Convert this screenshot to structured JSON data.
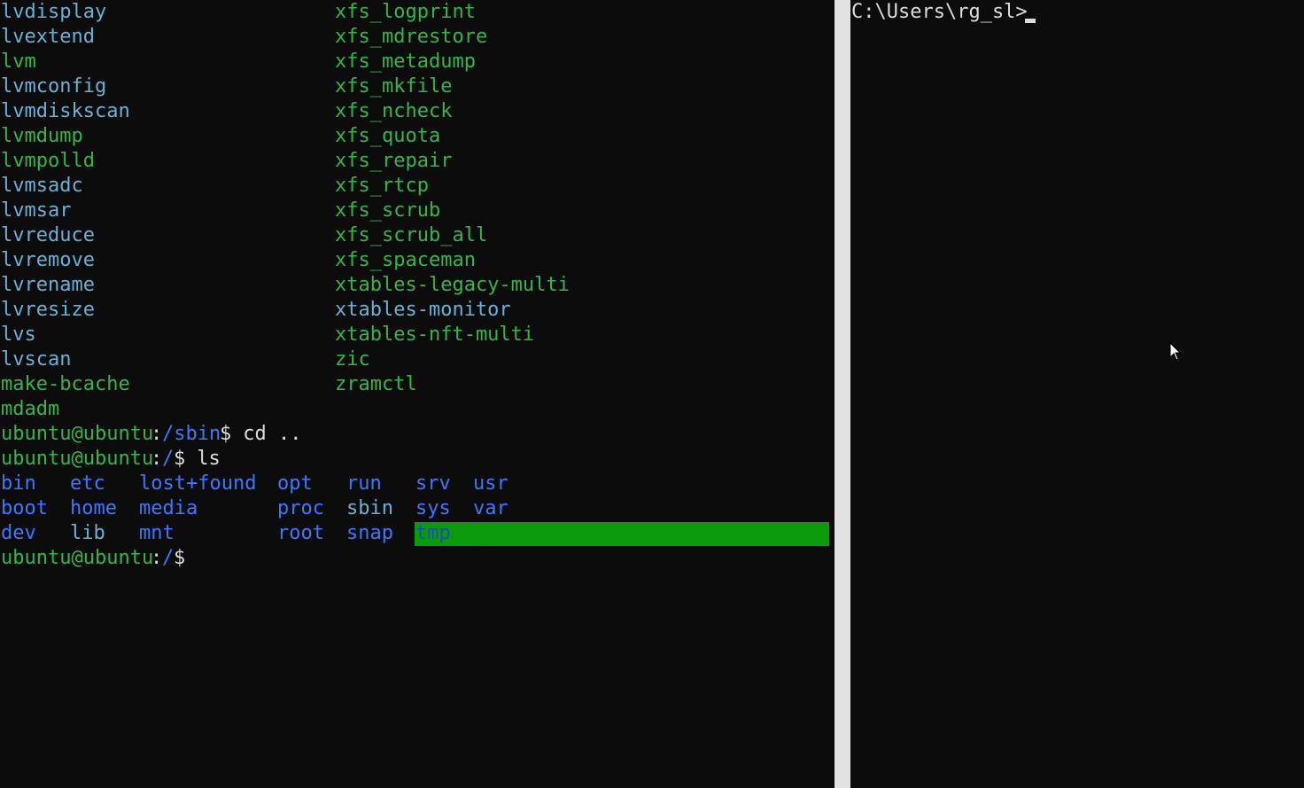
{
  "left_terminal": {
    "col1": [
      {
        "text": "lvdisplay",
        "color": "cyan"
      },
      {
        "text": "lvextend",
        "color": "cyan"
      },
      {
        "text": "lvm",
        "color": "green"
      },
      {
        "text": "lvmconfig",
        "color": "cyan"
      },
      {
        "text": "lvmdiskscan",
        "color": "cyan"
      },
      {
        "text": "lvmdump",
        "color": "green"
      },
      {
        "text": "lvmpolld",
        "color": "green"
      },
      {
        "text": "lvmsadc",
        "color": "cyan"
      },
      {
        "text": "lvmsar",
        "color": "cyan"
      },
      {
        "text": "lvreduce",
        "color": "cyan"
      },
      {
        "text": "lvremove",
        "color": "cyan"
      },
      {
        "text": "lvrename",
        "color": "cyan"
      },
      {
        "text": "lvresize",
        "color": "cyan"
      },
      {
        "text": "lvs",
        "color": "cyan"
      },
      {
        "text": "lvscan",
        "color": "cyan"
      },
      {
        "text": "make-bcache",
        "color": "green"
      },
      {
        "text": "mdadm",
        "color": "green"
      }
    ],
    "col2": [
      {
        "text": "xfs_logprint",
        "color": "green"
      },
      {
        "text": "xfs_mdrestore",
        "color": "green"
      },
      {
        "text": "xfs_metadump",
        "color": "green"
      },
      {
        "text": "xfs_mkfile",
        "color": "green"
      },
      {
        "text": "xfs_ncheck",
        "color": "green"
      },
      {
        "text": "xfs_quota",
        "color": "green"
      },
      {
        "text": "xfs_repair",
        "color": "green"
      },
      {
        "text": "xfs_rtcp",
        "color": "green"
      },
      {
        "text": "xfs_scrub",
        "color": "green"
      },
      {
        "text": "xfs_scrub_all",
        "color": "green"
      },
      {
        "text": "xfs_spaceman",
        "color": "green"
      },
      {
        "text": "xtables-legacy-multi",
        "color": "green"
      },
      {
        "text": "xtables-monitor",
        "color": "cyan"
      },
      {
        "text": "xtables-nft-multi",
        "color": "green"
      },
      {
        "text": "zic",
        "color": "green"
      },
      {
        "text": "zramctl",
        "color": "green"
      }
    ],
    "prompt1": {
      "user_host": "ubuntu@ubuntu",
      "sep": ":",
      "path": "/sbin",
      "dollar": "$",
      "cmd": " cd .."
    },
    "prompt2": {
      "user_host": "ubuntu@ubuntu",
      "sep": ":",
      "path": "/",
      "dollar": "$",
      "cmd": " ls"
    },
    "ls_rows": [
      [
        {
          "text": "bin",
          "color": "blue"
        },
        {
          "text": "etc",
          "color": "blue"
        },
        {
          "text": "lost+found",
          "color": "blue"
        },
        {
          "text": "opt",
          "color": "blue"
        },
        {
          "text": "run",
          "color": "blue"
        },
        {
          "text": "srv",
          "color": "blue"
        },
        {
          "text": "usr",
          "color": "blue"
        }
      ],
      [
        {
          "text": "boot",
          "color": "blue"
        },
        {
          "text": "home",
          "color": "blue"
        },
        {
          "text": "media",
          "color": "blue"
        },
        {
          "text": "proc",
          "color": "blue"
        },
        {
          "text": "sbin",
          "color": "cyan"
        },
        {
          "text": "sys",
          "color": "blue"
        },
        {
          "text": "var",
          "color": "blue"
        }
      ],
      [
        {
          "text": "dev",
          "color": "blue"
        },
        {
          "text": "lib",
          "color": "cyan"
        },
        {
          "text": "mnt",
          "color": "blue"
        },
        {
          "text": "root",
          "color": "blue"
        },
        {
          "text": "snap",
          "color": "blue"
        },
        {
          "text": "tmp",
          "color": "highlight"
        }
      ]
    ],
    "prompt3": {
      "user_host": "ubuntu@ubuntu",
      "sep": ":",
      "path": "/",
      "dollar": "$"
    }
  },
  "right_terminal": {
    "prompt": "C:\\Users\\rg_sl>"
  },
  "colors": {
    "background": "#0c0c0c",
    "green": "#35b548",
    "cyan": "#6ab0d6",
    "blue": "#3b78ff",
    "text": "#dcdcdc",
    "highlight_bg": "#0a9b0a",
    "divider": "#e2e2e2"
  }
}
